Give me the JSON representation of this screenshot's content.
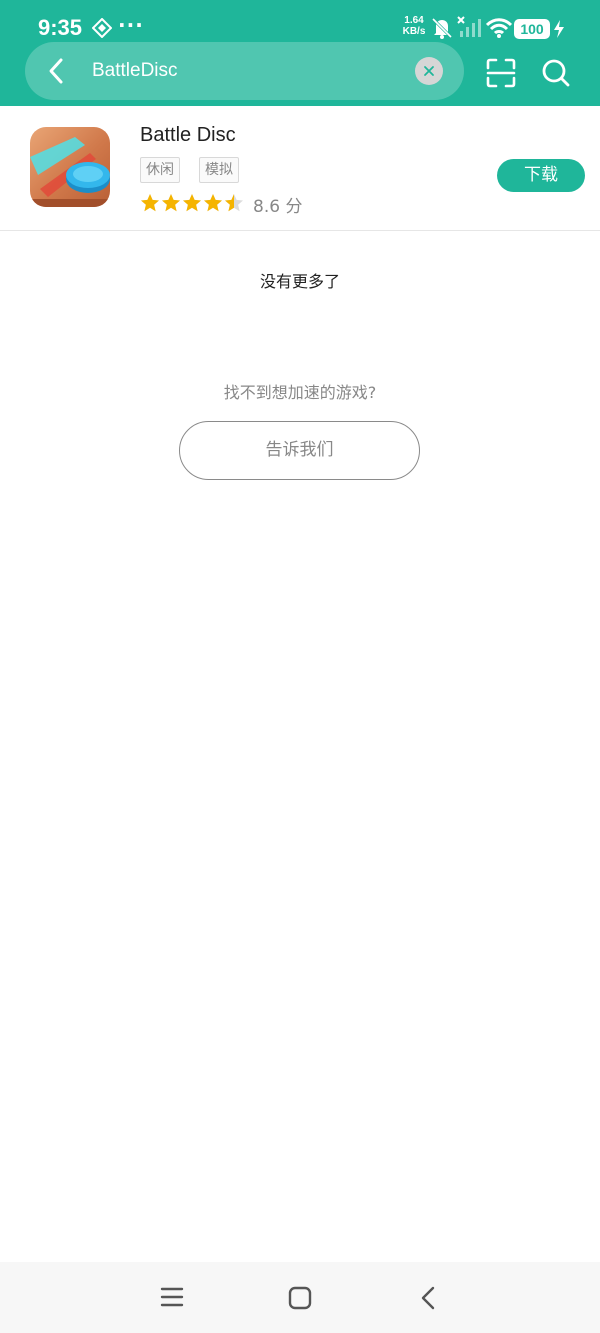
{
  "status_bar": {
    "time": "9:35",
    "more": "···",
    "net_speed_value": "1.64",
    "net_speed_unit": "KB/s",
    "battery": "100"
  },
  "search": {
    "query": "BattleDisc"
  },
  "result": {
    "name": "Battle Disc",
    "tags": [
      "休闲",
      "模拟"
    ],
    "rating_value": 4.5,
    "rating_max": 5,
    "rating_text": "8.6 分",
    "download_label": "下载"
  },
  "footer": {
    "no_more": "没有更多了",
    "not_found": "找不到想加速的游戏?",
    "tell_us": "告诉我们"
  },
  "colors": {
    "accent": "#1fb69a",
    "star": "#f5b400"
  }
}
